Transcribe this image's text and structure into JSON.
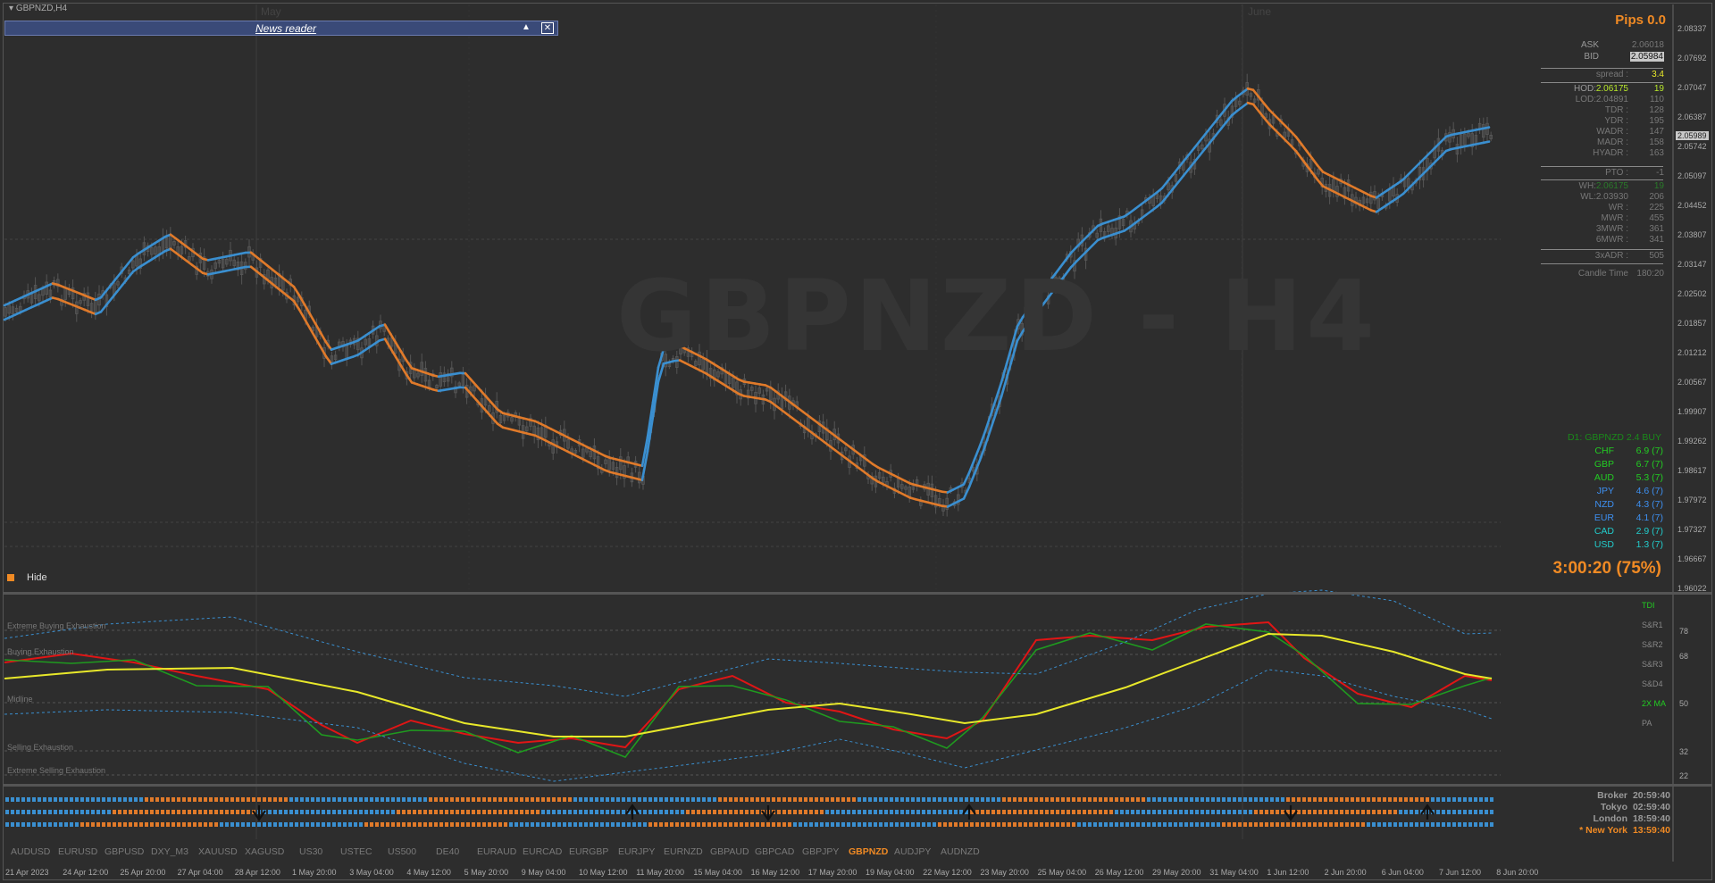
{
  "window": {
    "title": "GBPNZD,H4",
    "watermark": "GBPNZD - H4"
  },
  "news_reader": {
    "label": "News reader",
    "collapse_glyph": "▲",
    "close_glyph": "✕"
  },
  "months": [
    {
      "label": "May"
    },
    {
      "label": "June"
    }
  ],
  "price_axis": [
    "2.08337",
    "2.07692",
    "2.07047",
    "2.06387",
    "2.05742",
    "2.05097",
    "2.04452",
    "2.03807",
    "2.03147",
    "2.02502",
    "2.01857",
    "2.01212",
    "2.00567",
    "1.99907",
    "1.99262",
    "1.98617",
    "1.97972",
    "1.97327",
    "1.96667",
    "1.96022"
  ],
  "current_price": "2.05989",
  "info_panel": {
    "pips_label": "Pips 0.0",
    "ask_label": "ASK",
    "ask_value": "2.06018",
    "bid_label": "BID",
    "bid_value": "2.05984",
    "spread_label": "spread :",
    "spread_value": "3.4",
    "hod_label": "HOD:",
    "hod_price": "2.06175",
    "hod_value": "19",
    "lod_label": "LOD:",
    "lod_price": "2.04891",
    "lod_value": "110",
    "rows1": [
      {
        "k": "TDR :",
        "v": "128"
      },
      {
        "k": "YDR :",
        "v": "195"
      },
      {
        "k": "WADR :",
        "v": "147"
      },
      {
        "k": "MADR :",
        "v": "158"
      },
      {
        "k": "HYADR :",
        "v": "163"
      }
    ],
    "pto_label": "PTO :",
    "pto_value": "-1",
    "wh_label": "WH:",
    "wh_price": "2.06175",
    "wh_value": "19",
    "wl_label": "WL:",
    "wl_price": "2.03930",
    "wl_value": "206",
    "rows2": [
      {
        "k": "WR :",
        "v": "225"
      },
      {
        "k": "MWR :",
        "v": "455"
      },
      {
        "k": "3MWR :",
        "v": "361"
      },
      {
        "k": "6MWR :",
        "v": "341"
      }
    ],
    "adr3_label": "3xADR :",
    "adr3_value": "505",
    "candle_label": "Candle Time",
    "candle_value": "180:20",
    "timer": "3:00:20 (75%)"
  },
  "strength": {
    "header": "D1: GBPNZD 2.4 BUY",
    "rows": [
      {
        "c": "CHF",
        "v": "6.9 (7)",
        "color": "#22cc22"
      },
      {
        "c": "GBP",
        "v": "6.7 (7)",
        "color": "#22cc22"
      },
      {
        "c": "AUD",
        "v": "5.3 (7)",
        "color": "#22cc22"
      },
      {
        "c": "JPY",
        "v": "4.6 (7)",
        "color": "#3d8ff0"
      },
      {
        "c": "NZD",
        "v": "4.3 (7)",
        "color": "#3d8ff0"
      },
      {
        "c": "EUR",
        "v": "4.1 (7)",
        "color": "#3d8ff0"
      },
      {
        "c": "CAD",
        "v": "2.9 (7)",
        "color": "#22cccc"
      },
      {
        "c": "USD",
        "v": "1.3 (7)",
        "color": "#22cccc"
      }
    ]
  },
  "hide_label": "Hide",
  "tdi": {
    "zone_labels": [
      "Extreme Buying Exhaustion",
      "Buying Exhaustion",
      "Midline",
      "Selling Exhaustion",
      "Extreme Selling Exhaustion"
    ],
    "right_labels": [
      "TDI",
      "S&R1",
      "S&R2",
      "S&R3",
      "S&D4",
      "2X MA",
      "PA"
    ],
    "levels": [
      "78",
      "68",
      "50",
      "32",
      "22"
    ]
  },
  "sessions": [
    {
      "name": "Broker",
      "time": "20:59:40",
      "color": "#9a9a9a"
    },
    {
      "name": "Tokyo",
      "time": "02:59:40",
      "color": "#9a9a9a"
    },
    {
      "name": "London",
      "time": "18:59:40",
      "color": "#9a9a9a"
    },
    {
      "name": "* New York",
      "time": "13:59:40",
      "color": "#f08a24"
    }
  ],
  "symbol_tabs": [
    "AUDUSD",
    "EURUSD",
    "GBPUSD",
    "DXY_M3",
    "XAUUSD",
    "XAGUSD",
    "US30",
    "USTEC",
    "US500",
    "DE40",
    "EURAUD",
    "EURCAD",
    "EURGBP",
    "EURJPY",
    "EURNZD",
    "GBPAUD",
    "GBPCAD",
    "GBPJPY",
    "GBPNZD",
    "AUDJPY",
    "AUDNZD"
  ],
  "active_symbol": "GBPNZD",
  "time_axis": [
    "21 Apr 2023",
    "24 Apr 12:00",
    "25 Apr 20:00",
    "27 Apr 04:00",
    "28 Apr 12:00",
    "1 May 20:00",
    "3 May 04:00",
    "4 May 12:00",
    "5 May 20:00",
    "9 May 04:00",
    "10 May 12:00",
    "11 May 20:00",
    "15 May 04:00",
    "16 May 12:00",
    "17 May 20:00",
    "19 May 04:00",
    "22 May 12:00",
    "23 May 20:00",
    "25 May 04:00",
    "26 May 12:00",
    "29 May 20:00",
    "31 May 04:00",
    "1 Jun 12:00",
    "2 Jun 20:00",
    "6 Jun 04:00",
    "7 Jun 12:00",
    "8 Jun 20:00"
  ],
  "colors": {
    "ma_up": "#3a8fd0",
    "ma_down": "#e07a2a",
    "tdi_green": "#1f9a1f",
    "tdi_red": "#e01515",
    "tdi_yellow": "#e8e82a",
    "band": "#3a8fd0",
    "accent_orange": "#f08a24"
  }
}
